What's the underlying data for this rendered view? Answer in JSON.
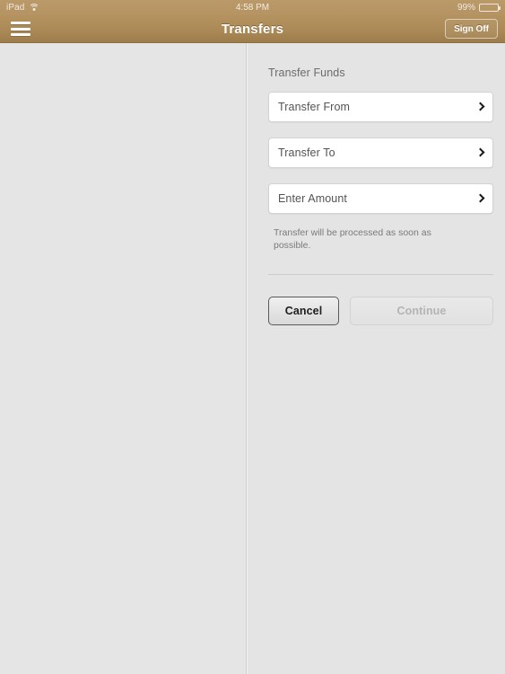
{
  "status_bar": {
    "device": "iPad",
    "wifi_icon": "wifi-icon",
    "time": "4:58 PM",
    "battery_percent": "99%",
    "battery_level": 93
  },
  "nav_bar": {
    "menu_icon": "hamburger-menu-icon",
    "title": "Transfers",
    "signoff_label": "Sign Off"
  },
  "form": {
    "section_title": "Transfer Funds",
    "fields": [
      {
        "label": "Transfer From",
        "value": "",
        "chevron": "chevron-right-icon"
      },
      {
        "label": "Transfer To",
        "value": "",
        "chevron": "chevron-right-icon"
      },
      {
        "label": "Enter Amount",
        "value": "",
        "chevron": "chevron-right-icon"
      }
    ],
    "help_text": "Transfer will be processed as soon as possible.",
    "buttons": {
      "cancel": "Cancel",
      "continue": "Continue"
    }
  },
  "colors": {
    "nav_bar_top": "#b5935f",
    "nav_bar_bottom": "#9e7d4c",
    "status_bar": "#b59363",
    "page_background": "#e4e4e4",
    "field_background": "#ffffff",
    "disabled_text": "#b4b4b4"
  }
}
